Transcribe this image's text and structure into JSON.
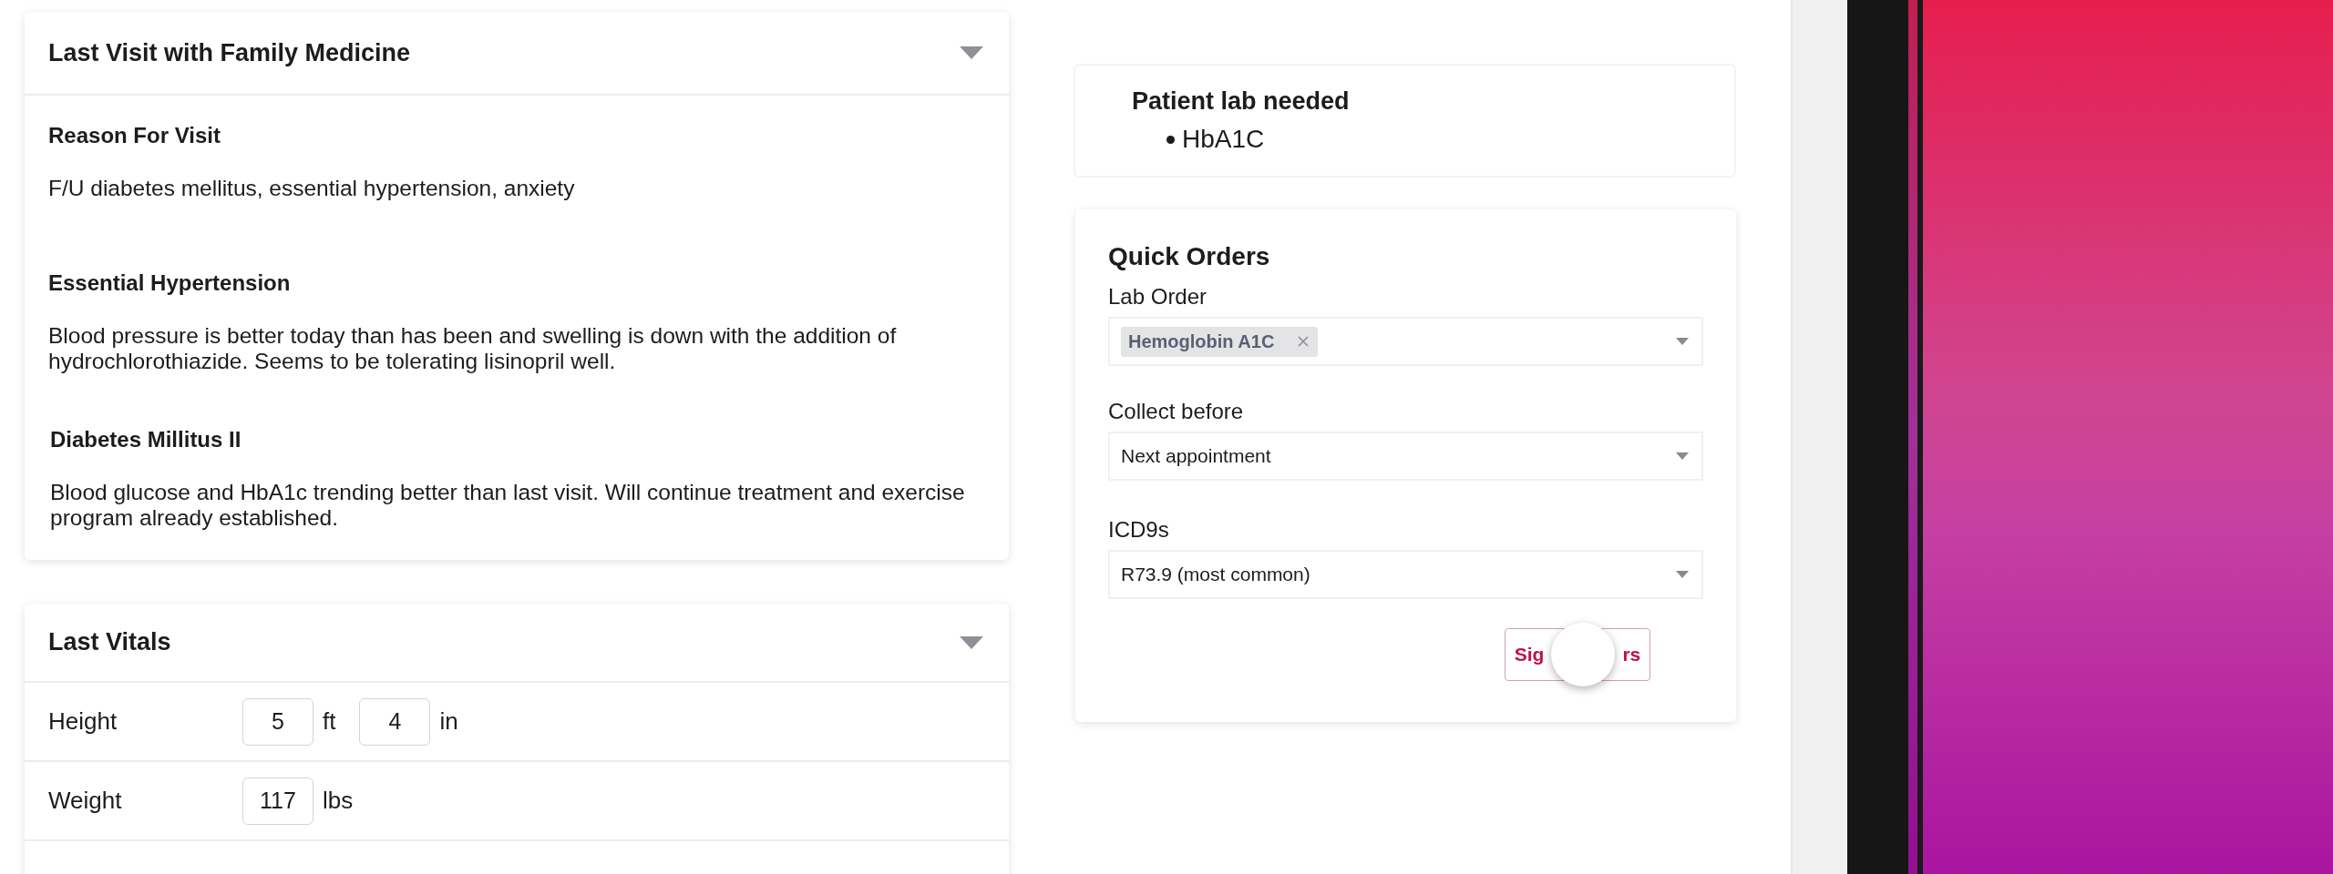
{
  "visit_card": {
    "title": "Last Visit with Family Medicine",
    "sections": [
      {
        "heading": "Reason For Visit",
        "text": "F/U diabetes mellitus, essential hypertension, anxiety"
      },
      {
        "heading": "Essential Hypertension",
        "text": "Blood pressure is better today than has been and swelling is down with the addition of hydrochlorothiazide. Seems to be tolerating lisinopril well."
      },
      {
        "heading": "Diabetes Millitus II",
        "text": "Blood glucose and HbA1c trending better than last visit. Will continue treatment and exercise program already established."
      }
    ]
  },
  "vitals_card": {
    "title": "Last Vitals",
    "rows": [
      {
        "label": "Height",
        "fields": [
          {
            "value": "5",
            "unit": "ft"
          },
          {
            "value": "4",
            "unit": "in"
          }
        ]
      },
      {
        "label": "Weight",
        "fields": [
          {
            "value": "117",
            "unit": "lbs"
          }
        ]
      }
    ]
  },
  "lab_needed": {
    "title": "Patient lab needed",
    "items": [
      "HbA1C"
    ]
  },
  "quick_orders": {
    "title": "Quick Orders",
    "fields": [
      {
        "kind": "tags",
        "label": "Lab Order",
        "tags": [
          "Hemoglobin A1C"
        ]
      },
      {
        "kind": "select",
        "label": "Collect before",
        "value": "Next appointment"
      },
      {
        "kind": "select",
        "label": "ICD9s",
        "value": "R73.9 (most common)"
      }
    ],
    "button": {
      "visible_text": [
        "Sig",
        "rs"
      ]
    }
  }
}
